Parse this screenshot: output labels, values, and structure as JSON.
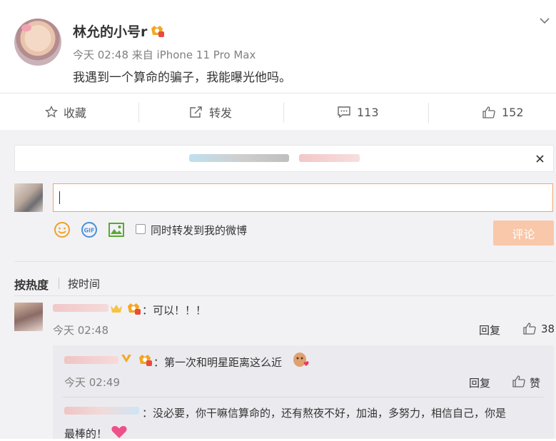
{
  "post": {
    "author": "林允的小号r",
    "meta": "今天 02:48 来自 iPhone 11 Pro Max",
    "text": "我遇到一个算命的骗子，我能曝光他吗。"
  },
  "actions": {
    "favorite_label": "收藏",
    "repost_label": "转发",
    "comment_count": "113",
    "like_count": "152"
  },
  "composer": {
    "repost_option_label": "同时转发到我的微博",
    "submit_label": "评论",
    "input_value": ""
  },
  "sort": {
    "hot_label": "按热度",
    "time_label": "按时间"
  },
  "comments": [
    {
      "text": "：可以！！！",
      "time": "今天 02:48",
      "reply_label": "回复",
      "like_count": "38",
      "replies": [
        {
          "text": "：第一次和明星距离这么近",
          "time": "今天 02:49",
          "reply_label": "回复",
          "like_label": "赞"
        },
        {
          "text_line1": "：没必要，你干嘛信算命的，还有熬夜不好，加油，多努力，相信自己，你是",
          "text_line2": "最棒的！"
        }
      ]
    }
  ],
  "colors": {
    "accent_orange": "#f3a36b",
    "submit_disabled": "#f9c7a9",
    "panel_bg": "#f2f2f5"
  },
  "icons": [
    "star-icon",
    "repost-icon",
    "comment-icon",
    "like-icon",
    "chevron-down-icon",
    "smile-icon",
    "gif-icon",
    "image-icon",
    "close-icon",
    "vip-badge-icon",
    "crown-icon",
    "heart-icon"
  ]
}
